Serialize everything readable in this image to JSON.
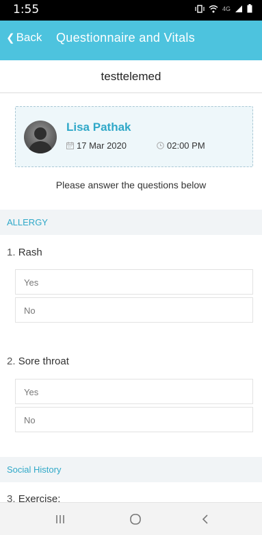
{
  "status": {
    "time": "1:55",
    "network": "4G"
  },
  "header": {
    "back_label": "Back",
    "title": "Questionnaire and Vitals"
  },
  "clinic": {
    "name": "testtelemed"
  },
  "patient": {
    "name": "Lisa Pathak",
    "date": "17 Mar 2020",
    "time": "02:00 PM"
  },
  "instructions": "Please answer the questions below",
  "sections": [
    {
      "title": "ALLERGY"
    },
    {
      "title": "Social History"
    }
  ],
  "questions": [
    {
      "number": "1.",
      "text": "Rash",
      "options": [
        "Yes",
        "No"
      ]
    },
    {
      "number": "2.",
      "text": "Sore throat",
      "options": [
        "Yes",
        "No"
      ]
    },
    {
      "number": "3.",
      "text": "Exercise:"
    }
  ],
  "nav": {
    "recent_icon": "recent-apps-icon",
    "home_icon": "home-icon",
    "back_icon": "back-icon"
  },
  "colors": {
    "accent": "#4dc3de",
    "name": "#2fa8c8",
    "section_bg": "#f1f4f6"
  }
}
